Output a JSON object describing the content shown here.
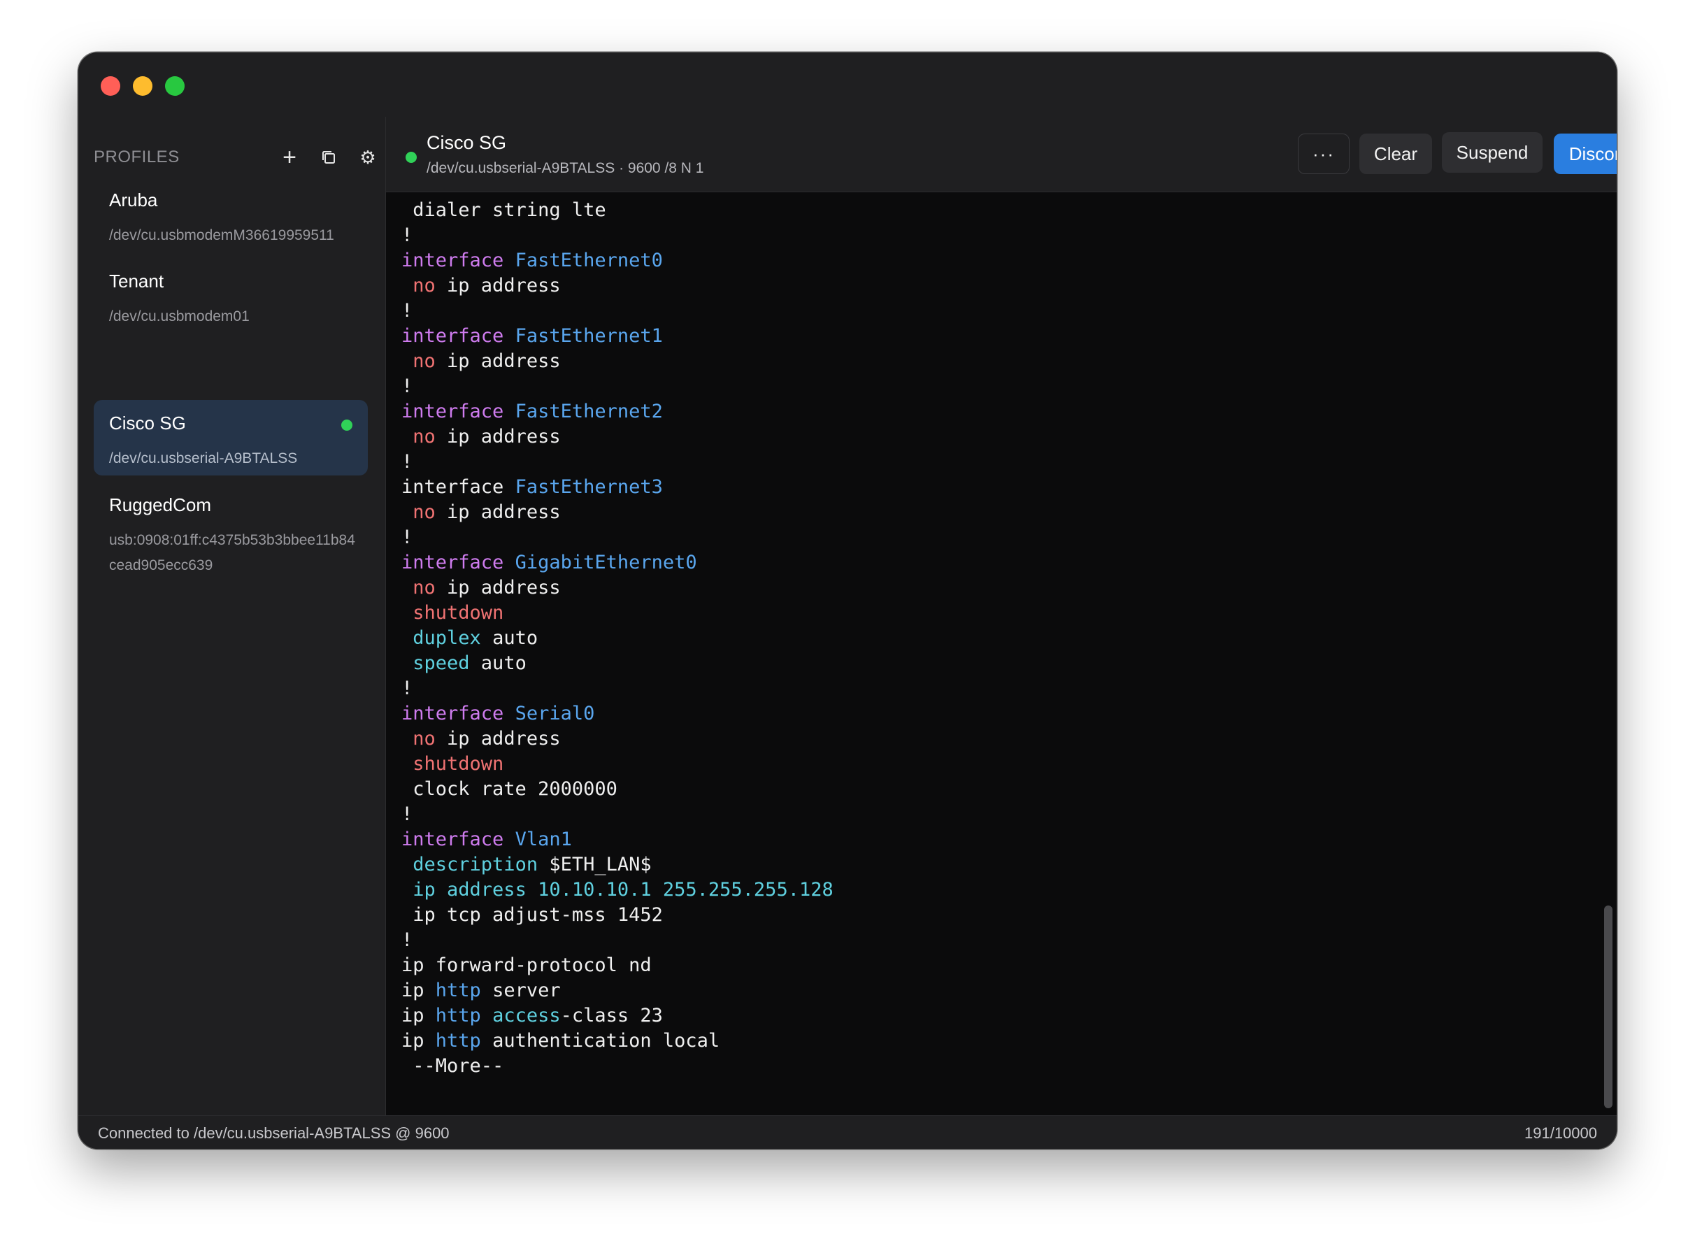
{
  "sidebar": {
    "title": "PROFILES",
    "tools": {
      "add": "+",
      "settings": "⚙"
    },
    "profiles": [
      {
        "name": "Aruba",
        "path": "/dev/cu.usbmodemM36619959511",
        "active": false,
        "connected": false
      },
      {
        "name": "Tenant",
        "path": "/dev/cu.usbmodem01",
        "active": false,
        "connected": false
      },
      {
        "name": "Cisco SG",
        "path": "/dev/cu.usbserial-A9BTALSS",
        "active": true,
        "connected": true
      },
      {
        "name": "RuggedCom",
        "path": "usb:0908:01ff:c4375b53b3bbee11b84cead905ecc639",
        "active": false,
        "connected": false
      }
    ]
  },
  "session": {
    "title": "Cisco SG",
    "subtitle": "/dev/cu.usbserial-A9BTALSS · 9600 /8 N 1",
    "status_color": "#30d158"
  },
  "toolbar": {
    "more_label": "···",
    "clear_label": "Clear",
    "suspend_label": "Suspend",
    "disconnect_label": "Disconnect",
    "accent_color": "#2a7ee0"
  },
  "terminal": {
    "lines": [
      [
        [
          " dialer string lte",
          ""
        ]
      ],
      [
        [
          "!",
          ""
        ]
      ],
      [
        [
          "interface",
          "kw"
        ],
        [
          " ",
          ""
        ],
        [
          "FastEthernet0",
          "blue"
        ]
      ],
      [
        [
          " ",
          ""
        ],
        [
          "no",
          "red"
        ],
        [
          " ip address",
          ""
        ]
      ],
      [
        [
          "!",
          ""
        ]
      ],
      [
        [
          "interface",
          "kw"
        ],
        [
          " ",
          ""
        ],
        [
          "FastEthernet1",
          "blue"
        ]
      ],
      [
        [
          " ",
          ""
        ],
        [
          "no",
          "red"
        ],
        [
          " ip address",
          ""
        ]
      ],
      [
        [
          "!",
          ""
        ]
      ],
      [
        [
          "interface",
          "kw"
        ],
        [
          " ",
          ""
        ],
        [
          "FastEthernet2",
          "blue"
        ]
      ],
      [
        [
          " ",
          ""
        ],
        [
          "no",
          "red"
        ],
        [
          " ip address",
          ""
        ]
      ],
      [
        [
          "!",
          ""
        ]
      ],
      [
        [
          "interface ",
          ""
        ],
        [
          "FastEthernet3",
          "blue"
        ]
      ],
      [
        [
          " ",
          ""
        ],
        [
          "no",
          "red"
        ],
        [
          " ip address",
          ""
        ]
      ],
      [
        [
          "!",
          ""
        ]
      ],
      [
        [
          "interface",
          "kw"
        ],
        [
          " ",
          ""
        ],
        [
          "GigabitEthernet0",
          "blue"
        ]
      ],
      [
        [
          " ",
          ""
        ],
        [
          "no",
          "red"
        ],
        [
          " ip address",
          ""
        ]
      ],
      [
        [
          " ",
          ""
        ],
        [
          "shutdown",
          "red"
        ]
      ],
      [
        [
          " ",
          ""
        ],
        [
          "duplex",
          "cyan"
        ],
        [
          " auto",
          ""
        ]
      ],
      [
        [
          " ",
          ""
        ],
        [
          "speed",
          "cyan"
        ],
        [
          " auto",
          ""
        ]
      ],
      [
        [
          "!",
          ""
        ]
      ],
      [
        [
          "interface",
          "kw"
        ],
        [
          " ",
          ""
        ],
        [
          "Serial0",
          "blue"
        ]
      ],
      [
        [
          " ",
          ""
        ],
        [
          "no",
          "red"
        ],
        [
          " ip address",
          ""
        ]
      ],
      [
        [
          " ",
          ""
        ],
        [
          "shutdown",
          "red"
        ]
      ],
      [
        [
          " clock rate 2000000",
          ""
        ]
      ],
      [
        [
          "!",
          ""
        ]
      ],
      [
        [
          "interface",
          "kw"
        ],
        [
          " ",
          ""
        ],
        [
          "Vlan1",
          "blue"
        ]
      ],
      [
        [
          " ",
          ""
        ],
        [
          "description",
          "cyan"
        ],
        [
          " $ETH_LAN$",
          ""
        ]
      ],
      [
        [
          " ",
          ""
        ],
        [
          "ip address 10.10.10.1 255.255.255.128",
          "cyan"
        ]
      ],
      [
        [
          " ip tcp adjust-mss 1452",
          ""
        ]
      ],
      [
        [
          "!",
          ""
        ]
      ],
      [
        [
          "ip forward-protocol nd",
          ""
        ]
      ],
      [
        [
          "ip ",
          ""
        ],
        [
          "http",
          "blue"
        ],
        [
          " server",
          ""
        ]
      ],
      [
        [
          "ip ",
          ""
        ],
        [
          "http",
          "blue"
        ],
        [
          " ",
          ""
        ],
        [
          "access",
          "cyan"
        ],
        [
          "-class 23",
          ""
        ]
      ],
      [
        [
          "ip ",
          ""
        ],
        [
          "http",
          "blue"
        ],
        [
          " authentication local",
          ""
        ]
      ],
      [
        [
          " --More--",
          ""
        ]
      ]
    ]
  },
  "statusbar": {
    "left": "Connected to /dev/cu.usbserial-A9BTALSS @ 9600",
    "right": "191/10000"
  }
}
